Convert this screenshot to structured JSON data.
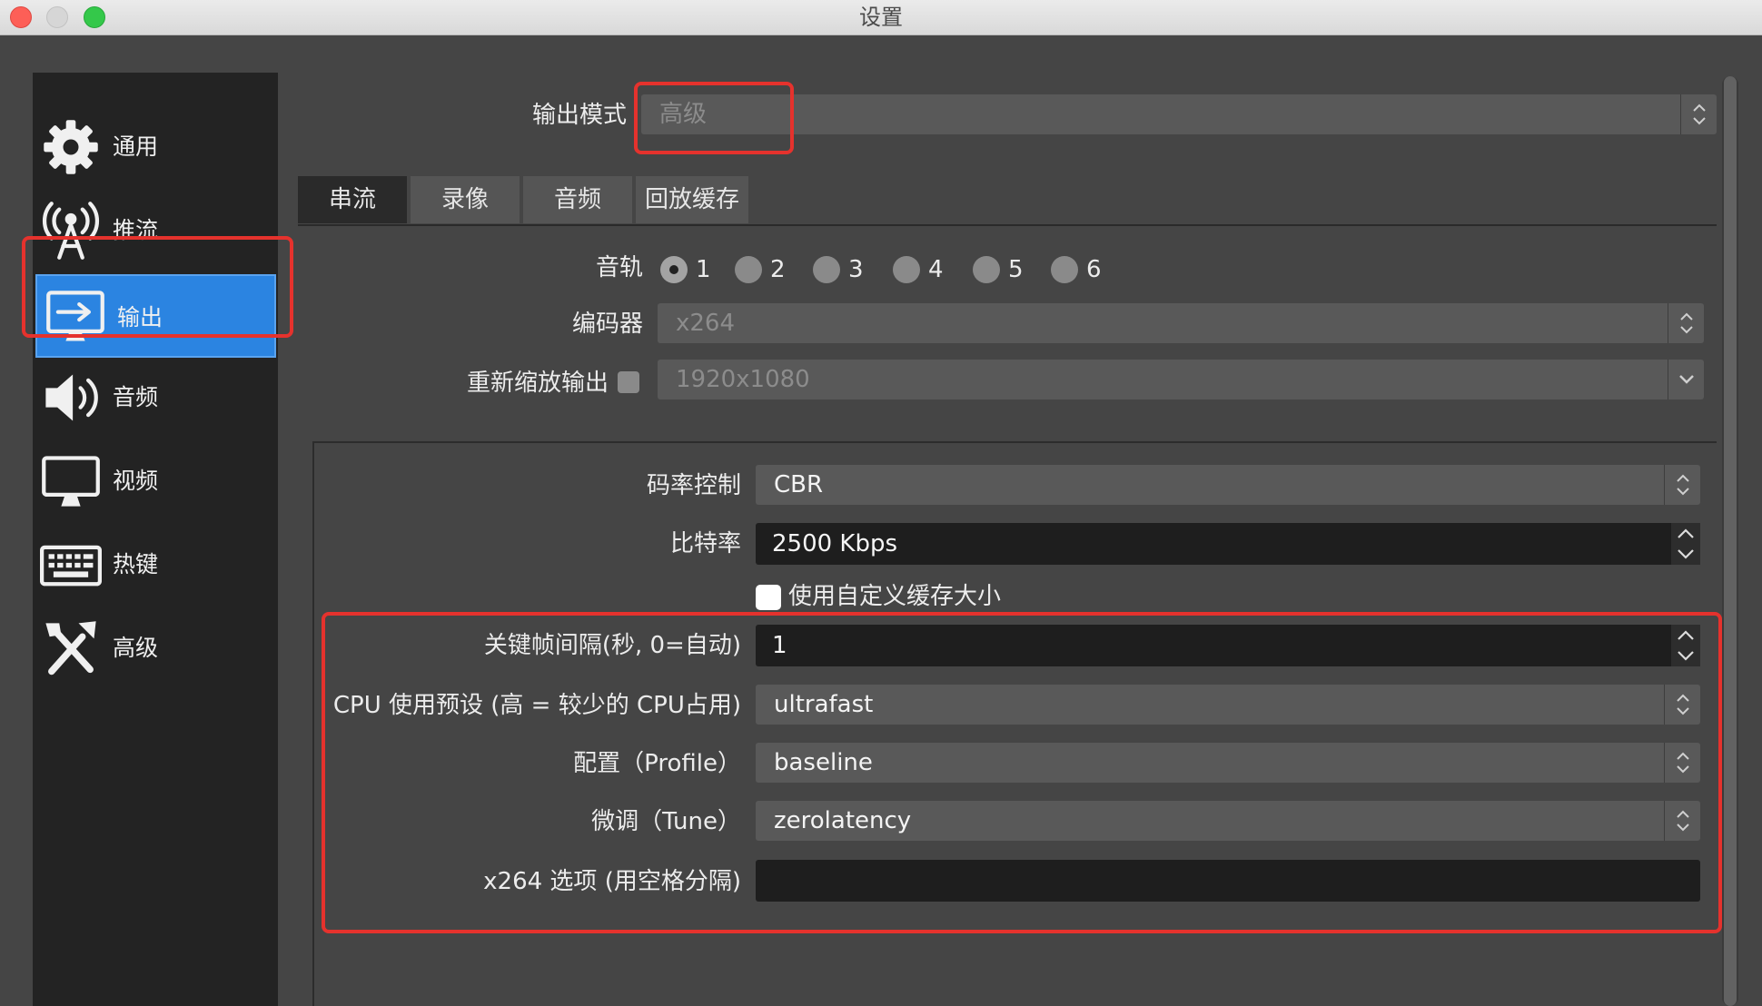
{
  "window": {
    "title": "设置"
  },
  "sidebar": {
    "items": [
      {
        "label": "通用",
        "icon": "gear-icon"
      },
      {
        "label": "推流",
        "icon": "broadcast-antenna-icon"
      },
      {
        "label": "输出",
        "icon": "monitor-output-icon"
      },
      {
        "label": "音频",
        "icon": "speaker-icon"
      },
      {
        "label": "视频",
        "icon": "monitor-icon"
      },
      {
        "label": "热键",
        "icon": "keyboard-icon"
      },
      {
        "label": "高级",
        "icon": "tools-icon"
      }
    ],
    "active": "输出"
  },
  "output_mode": {
    "label": "输出模式",
    "value": "高级"
  },
  "tabs": [
    {
      "label": "串流"
    },
    {
      "label": "录像"
    },
    {
      "label": "音频"
    },
    {
      "label": "回放缓存"
    }
  ],
  "streaming": {
    "audio_track": {
      "label": "音轨",
      "options": [
        "1",
        "2",
        "3",
        "4",
        "5",
        "6"
      ],
      "selected": "1"
    },
    "encoder": {
      "label": "编码器",
      "value": "x264"
    },
    "rescale": {
      "label": "重新缩放输出",
      "value": "1920x1080"
    },
    "rate_control": {
      "label": "码率控制",
      "value": "CBR"
    },
    "bitrate": {
      "label": "比特率",
      "value": "2500 Kbps"
    },
    "custom_buffer": {
      "label": "使用自定义缓存大小"
    },
    "keyframe": {
      "label": "关键帧间隔(秒, 0=自动)",
      "value": "1"
    },
    "cpu_preset": {
      "label": "CPU 使用预设 (高 = 较少的 CPU占用)",
      "value": "ultrafast"
    },
    "profile": {
      "label": "配置（Profile）",
      "value": "baseline"
    },
    "tune": {
      "label": "微调（Tune）",
      "value": "zerolatency"
    },
    "x264_opts": {
      "label": "x264 选项 (用空格分隔)",
      "value": ""
    }
  },
  "colors": {
    "accent": "#2b84e1",
    "highlight_box": "#e5322d",
    "panel": "#454545",
    "sidebar": "#232323"
  }
}
